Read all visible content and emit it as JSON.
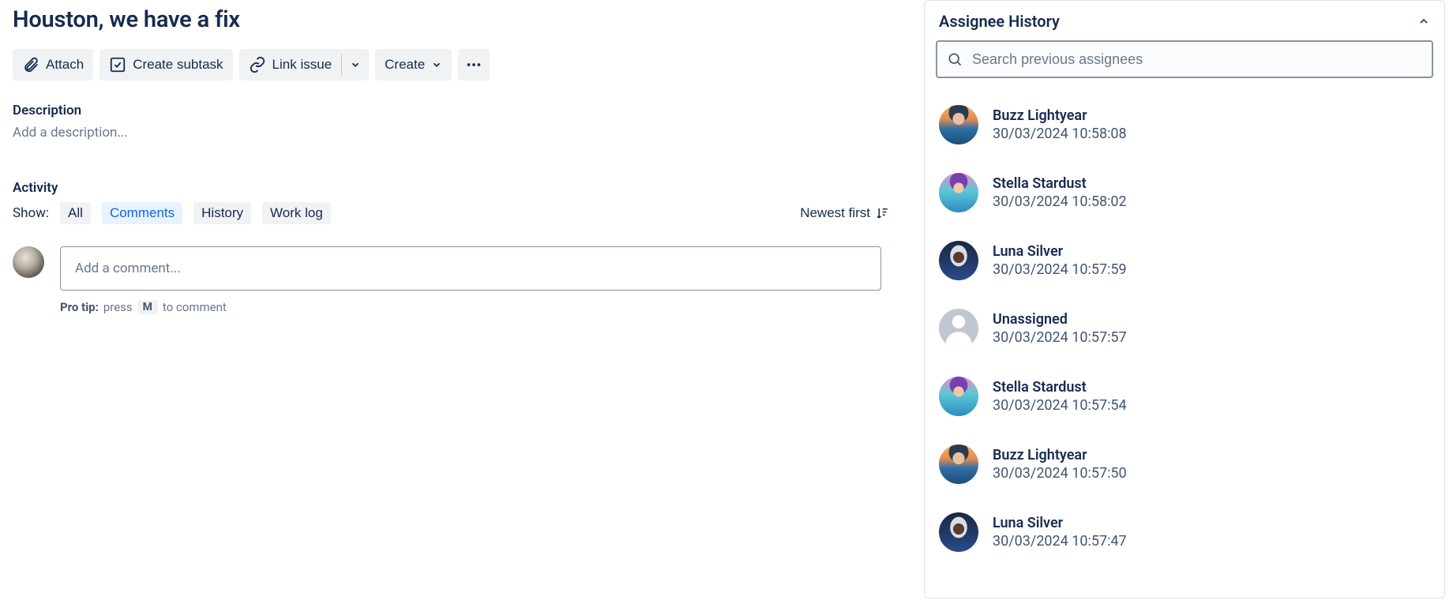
{
  "issue": {
    "title": "Houston, we have a fix"
  },
  "toolbar": {
    "attach": "Attach",
    "create_subtask": "Create subtask",
    "link_issue": "Link issue",
    "create": "Create"
  },
  "description": {
    "label": "Description",
    "placeholder": "Add a description..."
  },
  "activity": {
    "label": "Activity",
    "show_label": "Show:",
    "tabs": {
      "all": "All",
      "comments": "Comments",
      "history": "History",
      "worklog": "Work log"
    },
    "sort_label": "Newest first",
    "comment_placeholder": "Add a comment...",
    "pro_tip_prefix": "Pro tip:",
    "pro_tip_press": "press",
    "pro_tip_key": "M",
    "pro_tip_suffix": "to comment"
  },
  "panel": {
    "title": "Assignee History",
    "search_placeholder": "Search previous assignees",
    "entries": [
      {
        "name": "Buzz Lightyear",
        "ts": "30/03/2024 10:58:08",
        "avatar": "blue"
      },
      {
        "name": "Stella Stardust",
        "ts": "30/03/2024 10:58:02",
        "avatar": "pink"
      },
      {
        "name": "Luna Silver",
        "ts": "30/03/2024 10:57:59",
        "avatar": "space"
      },
      {
        "name": "Unassigned",
        "ts": "30/03/2024 10:57:57",
        "avatar": "unassigned"
      },
      {
        "name": "Stella Stardust",
        "ts": "30/03/2024 10:57:54",
        "avatar": "pink"
      },
      {
        "name": "Buzz Lightyear",
        "ts": "30/03/2024 10:57:50",
        "avatar": "blue"
      },
      {
        "name": "Luna Silver",
        "ts": "30/03/2024 10:57:47",
        "avatar": "space"
      }
    ]
  }
}
